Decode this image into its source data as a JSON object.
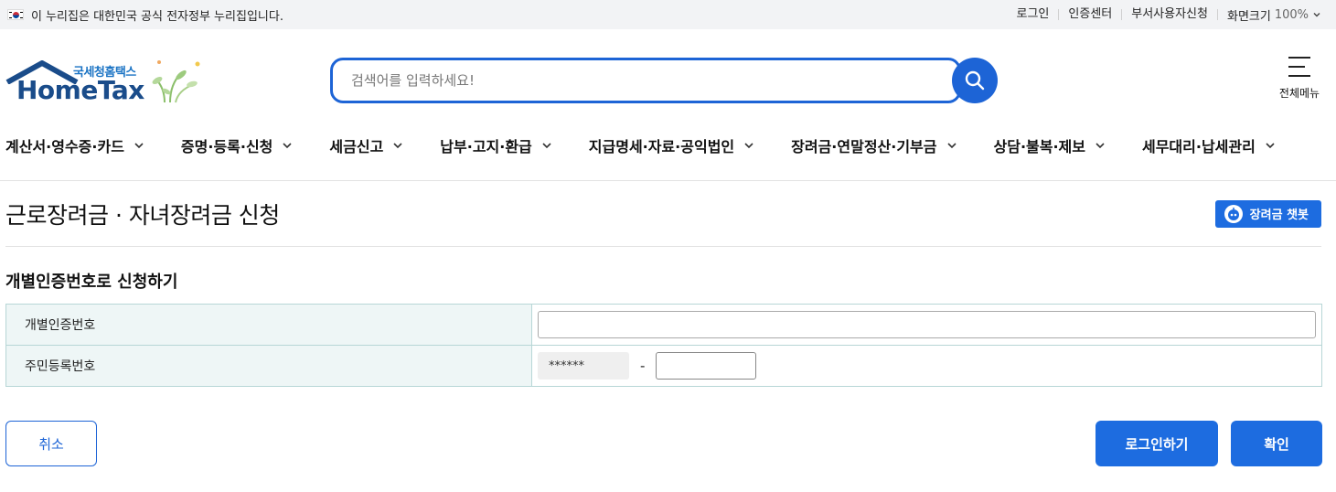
{
  "topbar": {
    "notice": "이 누리집은 대한민국 공식 전자정부 누리집입니다.",
    "links": [
      "로그인",
      "인증센터",
      "부서사용자신청"
    ],
    "zoom_label": "화면크기",
    "zoom_value": "100%"
  },
  "logo": {
    "korean": "국세청홈택스",
    "english": "HomeTax"
  },
  "search": {
    "placeholder": "검색어를 입력하세요!"
  },
  "all_menu": {
    "label": "전체메뉴"
  },
  "gnb": [
    "계산서·영수증·카드",
    "증명·등록·신청",
    "세금신고",
    "납부·고지·환급",
    "지급명세·자료·공익법인",
    "장려금·연말정산·기부금",
    "상담·불복·제보",
    "세무대리·납세관리"
  ],
  "page": {
    "title": "근로장려금 · 자녀장려금 신청",
    "chatbot_label": "장려금 챗봇",
    "section_title": "개별인증번호로 신청하기"
  },
  "form": {
    "auth_label": "개별인증번호",
    "auth_value": "",
    "rrn_label": "주민등록번호",
    "rrn_front_masked": "******",
    "rrn_dash": "-",
    "rrn_back_value": ""
  },
  "buttons": {
    "cancel": "취소",
    "login": "로그인하기",
    "confirm": "확인"
  },
  "colors": {
    "primary": "#1d64d6",
    "button": "#1d6ce0",
    "table_header_bg": "#eef6f6"
  }
}
